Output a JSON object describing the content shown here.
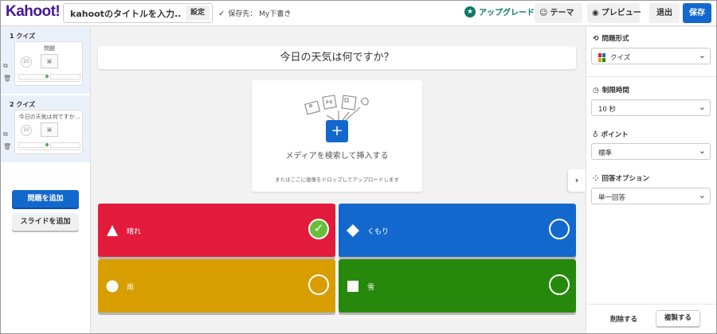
{
  "header": {
    "logo": "Kahoot!",
    "title_placeholder": "kahootのタイトルを入力...",
    "settings": "設定",
    "saved": "保存先： My下書き",
    "upgrade": "アップグレード",
    "theme": "テーマ",
    "preview": "プレビュー",
    "exit": "退出",
    "save": "保存"
  },
  "sidebar": {
    "slides": [
      {
        "label": "1 クイズ",
        "thumb_title": "問題",
        "timer": "20"
      },
      {
        "label": "2 クイズ",
        "thumb_title": "今日の天気は何ですか...",
        "timer": "10"
      }
    ],
    "add_question": "問題を追加",
    "add_slide": "スライドを追加"
  },
  "main": {
    "question": "今日の天気は何ですか？",
    "media_main": "メディアを検索して挿入する",
    "media_sub": "またはここに画像をドロップしてアップロードします",
    "answers": [
      {
        "text": "晴れ",
        "color": "#e21b3c",
        "shape": "triangle",
        "correct": true
      },
      {
        "text": "くもり",
        "color": "#1368ce",
        "shape": "diamond",
        "correct": false
      },
      {
        "text": "雨",
        "color": "#d89e00",
        "shape": "circle",
        "correct": false
      },
      {
        "text": "雪",
        "color": "#26890c",
        "shape": "square",
        "correct": false
      }
    ]
  },
  "panel": {
    "question_type_label": "問題形式",
    "question_type": "クイズ",
    "time_limit_label": "制限時間",
    "time_limit": "10 秒",
    "points_label": "ポイント",
    "points": "標準",
    "answer_options_label": "回答オプション",
    "answer_option": "単一回答",
    "delete": "削除する",
    "duplicate": "複製する"
  },
  "colors": {
    "accent": "#1368ce",
    "brand": "#46178f",
    "sidebar_selected": "#eaf1fb"
  }
}
